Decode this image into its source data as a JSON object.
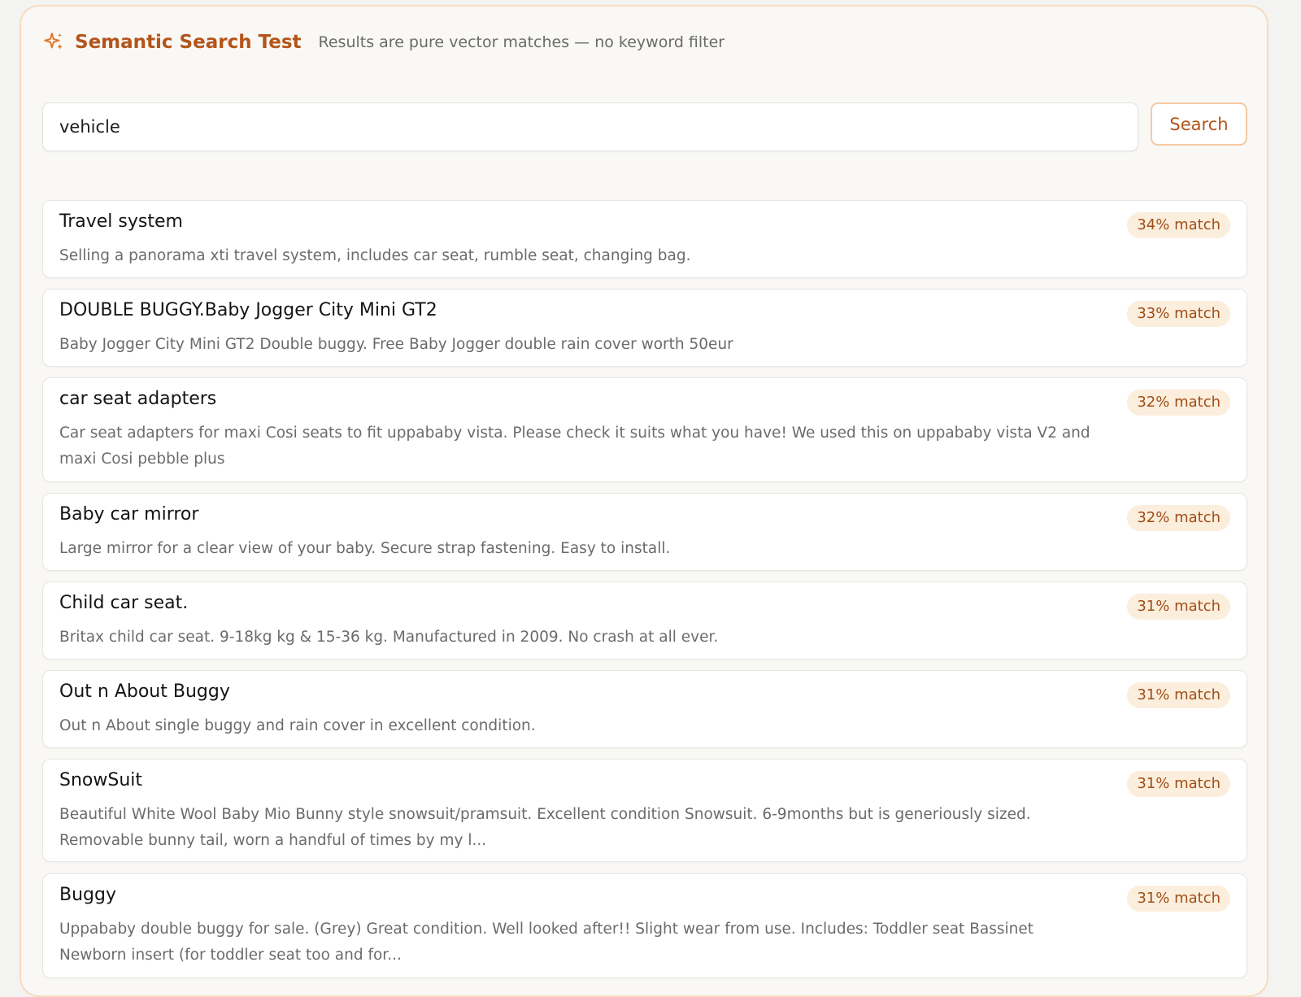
{
  "header": {
    "title": "Semantic Search Test",
    "subtitle": "Results are pure vector matches — no keyword filter",
    "icon": "sparkle-icon"
  },
  "search": {
    "value": "vehicle",
    "button_label": "Search"
  },
  "colors": {
    "accent": "#b4541a",
    "badge_background": "#fbeedd",
    "panel_border": "#f6dcc0"
  },
  "results": [
    {
      "title": "Travel system",
      "description": "Selling a panorama xti travel system, includes car seat, rumble seat, changing bag.",
      "match": "34% match"
    },
    {
      "title": "DOUBLE BUGGY.Baby Jogger City Mini GT2",
      "description": "Baby Jogger City Mini GT2 Double buggy. Free Baby Jogger double rain cover worth 50eur",
      "match": "33% match"
    },
    {
      "title": "car seat adapters",
      "description": "Car seat adapters for maxi Cosi seats to fit uppababy vista. Please check it suits what you have! We used this on uppababy vista V2 and maxi Cosi pebble plus",
      "match": "32% match"
    },
    {
      "title": "Baby car mirror",
      "description": "Large mirror for a clear view of your baby. Secure strap fastening. Easy to install.",
      "match": "32% match"
    },
    {
      "title": "Child car seat.",
      "description": "Britax child car seat. 9-18kg kg & 15-36 kg. Manufactured in 2009. No crash at all ever.",
      "match": "31% match"
    },
    {
      "title": "Out n About Buggy",
      "description": "Out n About single buggy and rain cover in excellent condition.",
      "match": "31% match"
    },
    {
      "title": "SnowSuit",
      "description": "Beautiful White Wool Baby Mio Bunny style snowsuit/pramsuit. Excellent condition Snowsuit. 6-9months but is generiously sized. Removable bunny tail, worn a handful of times by my l...",
      "match": "31% match"
    },
    {
      "title": "Buggy",
      "description": "Uppababy double buggy for sale. (Grey) Great condition. Well looked after!! Slight wear from use. Includes: Toddler seat Bassinet Newborn insert (for toddler seat too and for...",
      "match": "31% match"
    }
  ]
}
